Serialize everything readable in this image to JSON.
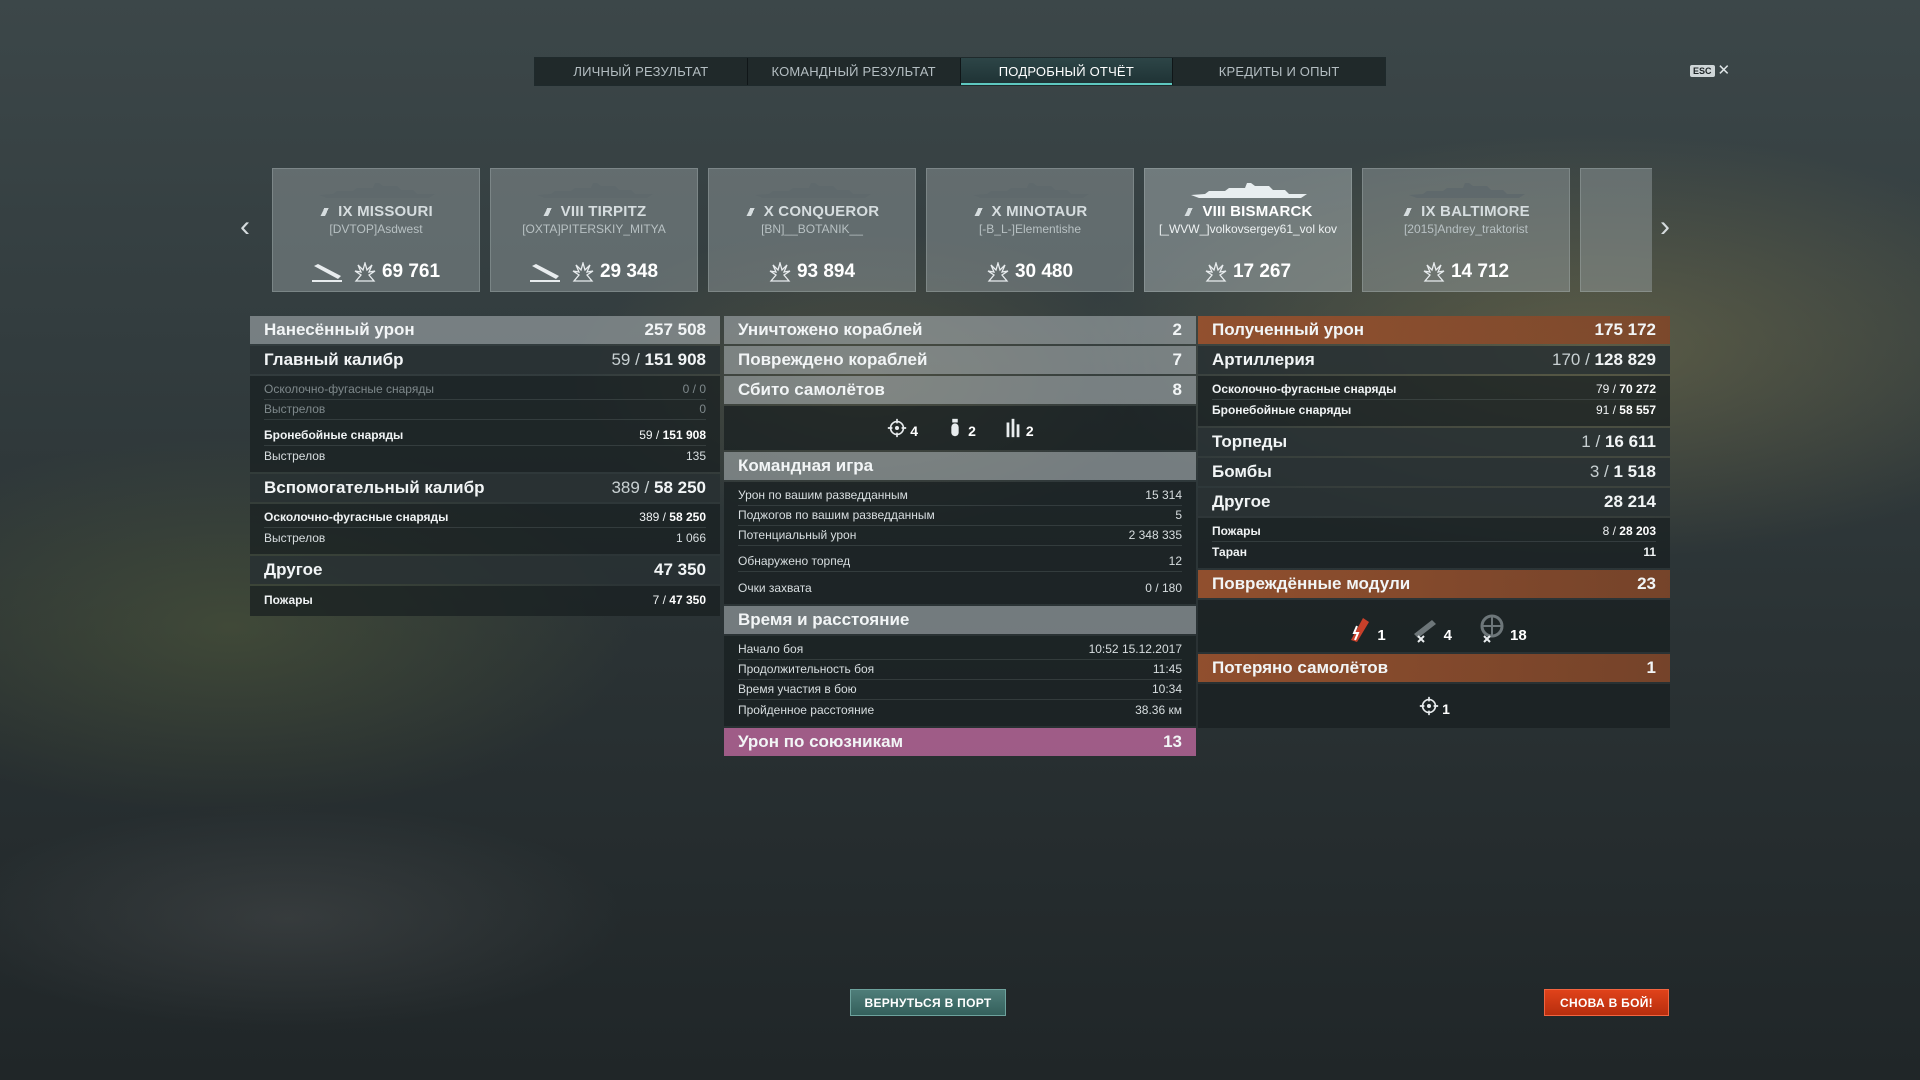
{
  "tabs": [
    {
      "label": "ЛИЧНЫЙ РЕЗУЛЬТАТ",
      "active": false
    },
    {
      "label": "КОМАНДНЫЙ РЕЗУЛЬТАТ",
      "active": false
    },
    {
      "label": "ПОДРОБНЫЙ ОТЧЁТ",
      "active": true
    },
    {
      "label": "КРЕДИТЫ И ОПЫТ",
      "active": false
    }
  ],
  "esc_label": "ESC",
  "ships": [
    {
      "name": "IX MISSOURI",
      "player": "[DVTOP]Asdwest",
      "damage": "69 761",
      "sunk": true
    },
    {
      "name": "VIII TIRPITZ",
      "player": "[OXTA]PITERSKIY_MITYA",
      "damage": "29 348",
      "sunk": true
    },
    {
      "name": "X CONQUEROR",
      "player": "[BN]__BOTANIK__",
      "damage": "93 894",
      "sunk": false
    },
    {
      "name": "X MINOTAUR",
      "player": "[-B_L-]Elementishe",
      "damage": "30 480",
      "sunk": false
    },
    {
      "name": "VIII BISMARCK",
      "player": "[_WVW_]volkovsergey61_vol kov",
      "damage": "17 267",
      "sunk": false,
      "is_player": true
    },
    {
      "name": "IX BALTIMORE",
      "player": "[2015]Andrey_traktorist",
      "damage": "14 712",
      "sunk": false
    }
  ],
  "left": {
    "dealt": {
      "label": "Нанесённый урон",
      "value": "257 508"
    },
    "main": {
      "label": "Главный калибр",
      "hits": "59",
      "value": "151 908"
    },
    "main_rows": [
      {
        "label": "Осколочно-фугасные снаряды",
        "value": "0 / 0"
      },
      {
        "label": "Выстрелов",
        "value": "0"
      },
      {
        "label": "Бронебойные снаряды",
        "hits": "59 / ",
        "value": "151 908"
      },
      {
        "label": "Выстрелов",
        "value": "135"
      }
    ],
    "secondary": {
      "label": "Вспомогательный калибр",
      "hits": "389",
      "value": "58 250"
    },
    "secondary_rows": [
      {
        "label": "Осколочно-фугасные снаряды",
        "hits": "389 / ",
        "value": "58 250"
      },
      {
        "label": "Выстрелов",
        "value": "1 066"
      }
    ],
    "other": {
      "label": "Другое",
      "value": "47 350"
    },
    "other_rows": [
      {
        "label": "Пожары",
        "hits": "7 / ",
        "value": "47 350"
      }
    ]
  },
  "mid": {
    "destroyed": {
      "label": "Уничтожено кораблей",
      "value": "2"
    },
    "damaged": {
      "label": "Повреждено кораблей",
      "value": "7"
    },
    "planes": {
      "label": "Сбито самолётов",
      "value": "8"
    },
    "plane_icons": [
      {
        "icon": "fighter-icon",
        "value": "4"
      },
      {
        "icon": "bomber-icon",
        "value": "2"
      },
      {
        "icon": "torpedo-bomber-icon",
        "value": "2"
      }
    ],
    "team": {
      "label": "Командная игра"
    },
    "team_rows": [
      {
        "label": "Урон по вашим разведданным",
        "value": "15 314"
      },
      {
        "label": "Поджогов по вашим разведданным",
        "value": "5"
      },
      {
        "label": "Потенциальный урон",
        "value": "2 348 335"
      },
      {
        "label": "Обнаружено торпед",
        "value": "12"
      },
      {
        "label": "Очки захвата",
        "value": "0 / 180"
      }
    ],
    "time": {
      "label": "Время и расстояние"
    },
    "time_rows": [
      {
        "label": "Начало боя",
        "value": "10:52  15.12.2017"
      },
      {
        "label": "Продолжительность боя",
        "value": "11:45"
      },
      {
        "label": "Время участия в бою",
        "value": "10:34"
      },
      {
        "label": "Пройденное расстояние",
        "value": "38.36 км"
      }
    ],
    "allies": {
      "label": "Урон по союзникам",
      "value": "13"
    }
  },
  "right": {
    "received": {
      "label": "Полученный урон",
      "value": "175 172"
    },
    "artillery": {
      "label": "Артиллерия",
      "hits": "170",
      "value": "128 829"
    },
    "artillery_rows": [
      {
        "label": "Осколочно-фугасные снаряды",
        "hits": "79 / ",
        "value": "70 272"
      },
      {
        "label": "Бронебойные снаряды",
        "hits": "91 / ",
        "value": "58 557"
      }
    ],
    "torpedoes": {
      "label": "Торпеды",
      "hits": "1",
      "value": "16 611"
    },
    "bombs": {
      "label": "Бомбы",
      "hits": "3",
      "value": "1 518"
    },
    "other": {
      "label": "Другое",
      "value": "28 214"
    },
    "other_rows": [
      {
        "label": "Пожары",
        "hits": "8 / ",
        "value": "28 203"
      },
      {
        "label": "Таран",
        "value": "11"
      }
    ],
    "modules": {
      "label": "Повреждённые модули",
      "value": "23"
    },
    "module_icons": [
      {
        "icon": "fire-module-icon",
        "value": "1"
      },
      {
        "icon": "gun-module-icon",
        "value": "4"
      },
      {
        "icon": "aa-module-icon",
        "value": "18"
      }
    ],
    "lost": {
      "label": "Потеряно самолётов",
      "value": "1"
    },
    "lost_icon": {
      "icon": "fighter-icon",
      "value": "1"
    }
  },
  "buttons": {
    "port": "ВЕРНУТЬСЯ В ПОРТ",
    "battle": "СНОВА В БОЙ!"
  },
  "colors": {
    "accent": "#5ec8c0",
    "received_header": "#9b522d",
    "allies_header": "#b46496",
    "battle_button": "#e0421a"
  }
}
